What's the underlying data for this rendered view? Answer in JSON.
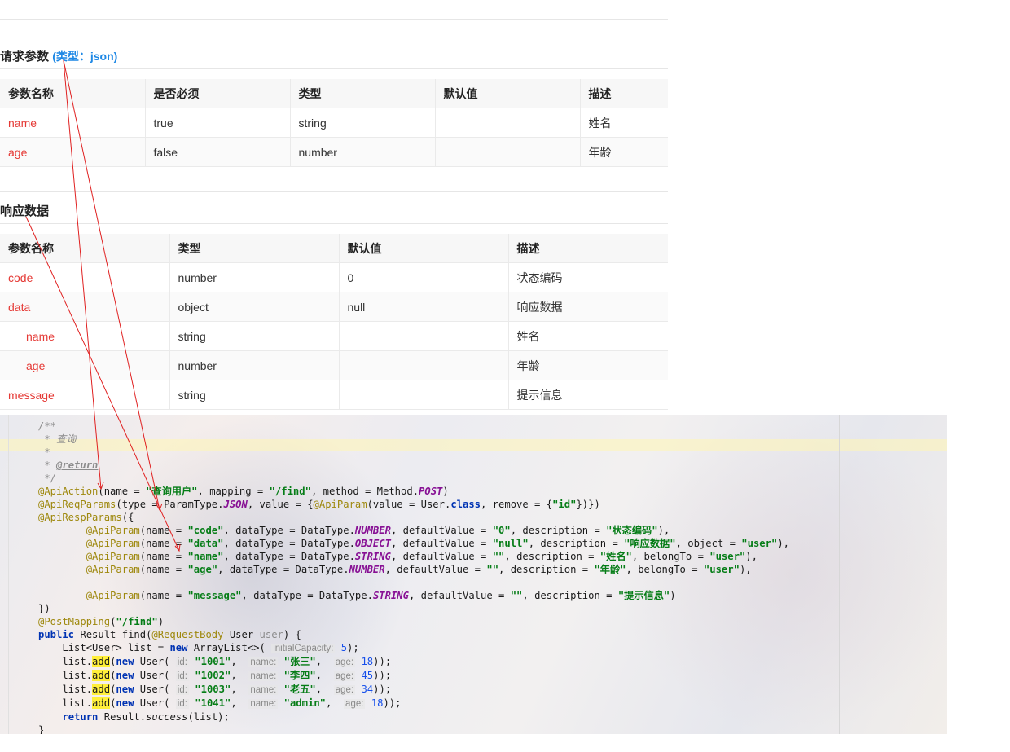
{
  "request": {
    "title": "请求参数",
    "type_label": "(类型：json)",
    "columns": [
      "参数名称",
      "是否必须",
      "类型",
      "默认值",
      "描述"
    ],
    "rows": [
      {
        "name": "name",
        "required": "true",
        "type": "string",
        "default": "",
        "desc": "姓名"
      },
      {
        "name": "age",
        "required": "false",
        "type": "number",
        "default": "",
        "desc": "年龄"
      }
    ]
  },
  "response": {
    "title": "响应数据",
    "columns": [
      "参数名称",
      "类型",
      "默认值",
      "描述"
    ],
    "rows": [
      {
        "name": "code",
        "type": "number",
        "default": "0",
        "desc": "状态编码"
      },
      {
        "name": "data",
        "type": "object",
        "default": "null",
        "desc": "响应数据"
      },
      {
        "name": "name",
        "type": "string",
        "default": "",
        "desc": "姓名"
      },
      {
        "name": "age",
        "type": "number",
        "default": "",
        "desc": "年龄"
      },
      {
        "name": "message",
        "type": "string",
        "default": "",
        "desc": "提示信息"
      }
    ]
  },
  "code": {
    "comment_text": "查询",
    "return_tag": "@return",
    "action_name": "\"查询用户\"",
    "mapping": "\"/find\"",
    "user_names": [
      "\"张三\"",
      "\"李四\"",
      "\"老五\"",
      "\"admin\""
    ],
    "user_ids": [
      "\"1001\"",
      "\"1002\"",
      "\"1003\"",
      "\"1041\""
    ],
    "user_ages": [
      "18",
      "45",
      "34",
      "18"
    ]
  },
  "colors": {
    "param_name": "#e53935",
    "accent": "#1e88e5",
    "arrow": "#e02020"
  }
}
